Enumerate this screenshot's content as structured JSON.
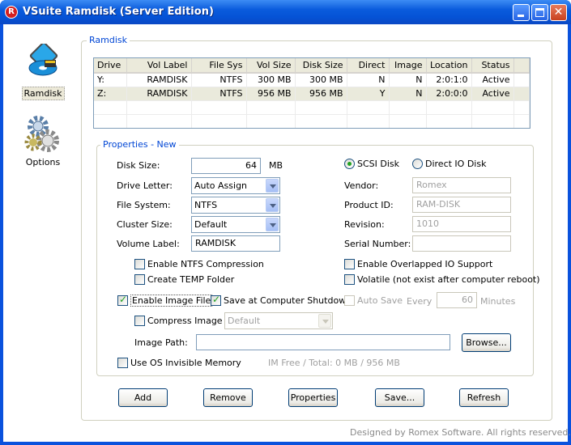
{
  "window": {
    "title": "VSuite Ramdisk (Server Edition)"
  },
  "nav": {
    "items": [
      {
        "label": "Ramdisk",
        "icon": "ramdisk-icon"
      },
      {
        "label": "Options",
        "icon": "options-gears-icon"
      }
    ]
  },
  "ramdisk": {
    "legend": "Ramdisk",
    "columns": [
      "Drive",
      "Vol Label",
      "File Sys",
      "Vol Size",
      "Disk Size",
      "Direct",
      "Image",
      "Location",
      "Status"
    ],
    "rows": [
      [
        "Y:",
        "RAMDISK",
        "NTFS",
        "300 MB",
        "300 MB",
        "N",
        "N",
        "2:0:1:0",
        "Active"
      ],
      [
        "Z:",
        "RAMDISK",
        "NTFS",
        "956 MB",
        "956 MB",
        "Y",
        "N",
        "2:0:0:0",
        "Active"
      ]
    ]
  },
  "props": {
    "legend": "Properties - New",
    "disk_size_label": "Disk Size:",
    "disk_size_value": "64",
    "disk_size_unit": "MB",
    "drive_letter_label": "Drive Letter:",
    "drive_letter_value": "Auto Assign",
    "file_system_label": "File System:",
    "file_system_value": "NTFS",
    "cluster_size_label": "Cluster Size:",
    "cluster_size_value": "Default",
    "volume_label_label": "Volume Label:",
    "volume_label_value": "RAMDISK",
    "scsi_label": "SCSI Disk",
    "direct_io_label": "Direct IO Disk",
    "vendor_label": "Vendor:",
    "vendor_value": "Romex",
    "product_label": "Product ID:",
    "product_value": "RAM-DISK",
    "revision_label": "Revision:",
    "revision_value": "1010",
    "serial_label": "Serial Number:",
    "serial_value": "",
    "ntfs_compression": "Enable NTFS Compression",
    "temp_folder": "Create TEMP Folder",
    "overlapped_io": "Enable Overlapped IO Support",
    "volatile": "Volatile (not exist after computer reboot)",
    "enable_image": "Enable Image File",
    "save_shutdown": "Save at Computer Shutdown",
    "auto_save": "Auto Save",
    "every": "Every",
    "every_value": "60",
    "minutes": "Minutes",
    "compress_image": "Compress Image",
    "compress_value": "Default",
    "image_path_label": "Image Path:",
    "image_path_value": "",
    "browse": "Browse...",
    "os_invisible": "Use OS Invisible Memory",
    "im_info": "IM Free / Total: 0 MB / 956 MB"
  },
  "buttons": {
    "add": "Add",
    "remove": "Remove",
    "properties": "Properties",
    "save": "Save...",
    "refresh": "Refresh"
  },
  "footer": "Designed by Romex Software. All rights reserved."
}
